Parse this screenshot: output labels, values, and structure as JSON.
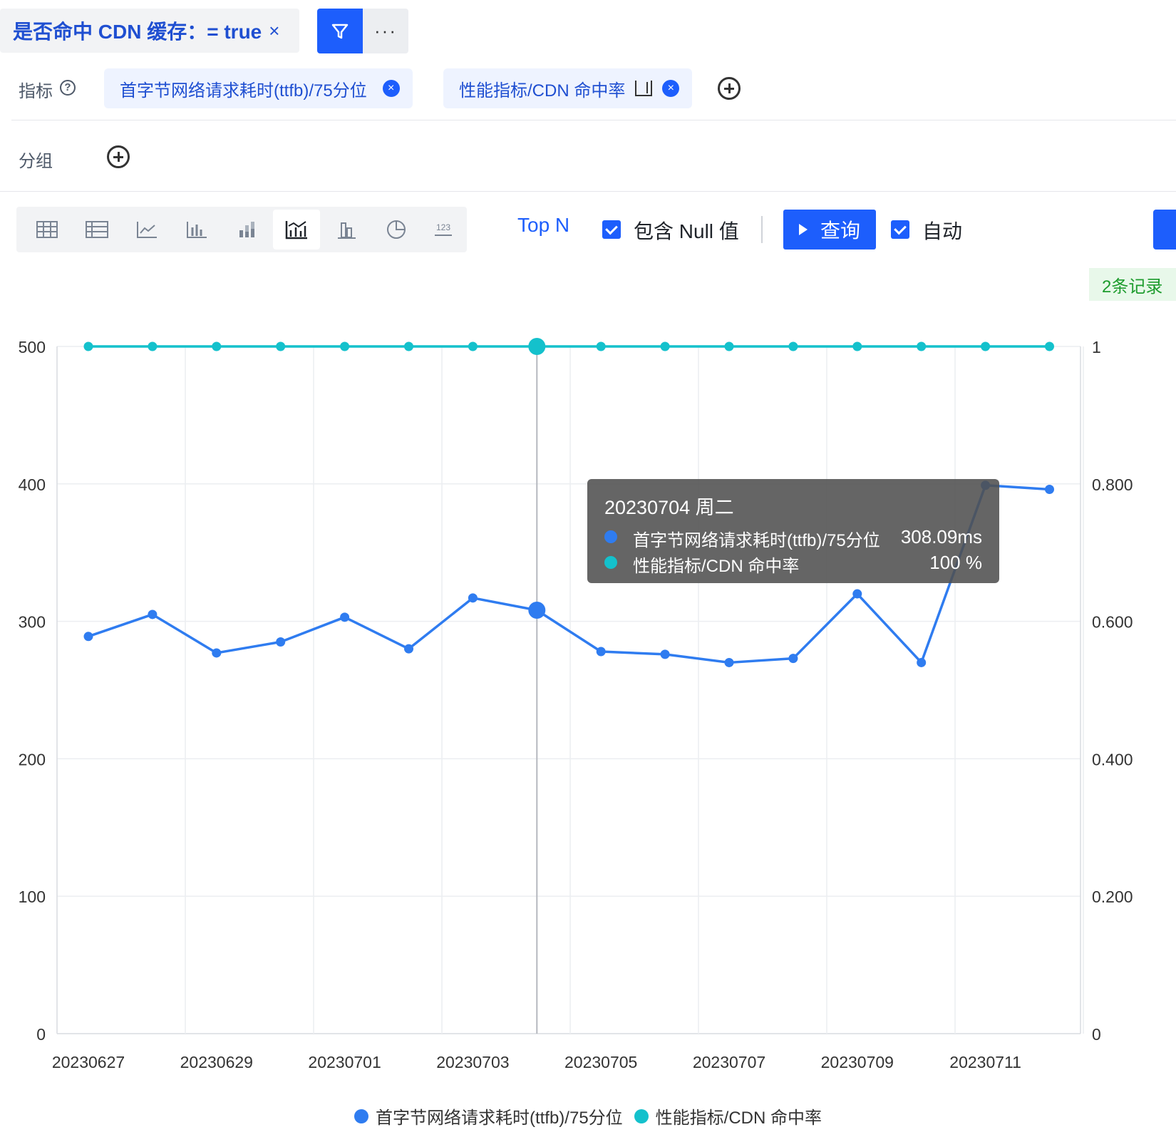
{
  "filter": {
    "label": "是否命中 CDN 缓存：= true",
    "close": "×"
  },
  "more_label": "···",
  "metrics_row": {
    "label": "指标",
    "help": "?",
    "chips": [
      {
        "label": "首字节网络请求耗时(ttfb)/75分位"
      },
      {
        "label": "性能指标/CDN 命中率"
      }
    ],
    "chip_close": "×"
  },
  "group_row": {
    "label": "分组"
  },
  "toolbar": {
    "chart_types": [
      "table-icon",
      "pivot-table-icon",
      "line-chart-icon",
      "bar-chart-icon",
      "stacked-bar-icon",
      "dual-axis-chart-icon",
      "column-chart-icon",
      "pie-chart-icon",
      "number-icon"
    ],
    "active_index": 5,
    "number_icon_text": "123",
    "top_n": "Top N",
    "include_null": "包含 Null 值",
    "query": "查询",
    "auto": "自动"
  },
  "records_badge": "2条记录",
  "colors": {
    "primary": "#1d5efc",
    "series1": "#2f7cf0",
    "series2": "#14c1cc"
  },
  "chart_data": {
    "type": "line",
    "x": [
      "20230627",
      "20230628",
      "20230629",
      "20230630",
      "20230701",
      "20230702",
      "20230703",
      "20230704",
      "20230705",
      "20230706",
      "20230707",
      "20230708",
      "20230709",
      "20230710",
      "20230711",
      "20230712"
    ],
    "x_tick_labels": [
      "20230627",
      "20230629",
      "20230701",
      "20230703",
      "20230705",
      "20230707",
      "20230709",
      "20230711"
    ],
    "series": [
      {
        "name": "首字节网络请求耗时(ttfb)/75分位",
        "axis": "left",
        "color": "#2f7cf0",
        "values": [
          289,
          305,
          277,
          285,
          303,
          280,
          317,
          308.09,
          278,
          276,
          270,
          273,
          320,
          270,
          399,
          396
        ]
      },
      {
        "name": "性能指标/CDN 命中率",
        "axis": "right",
        "color": "#14c1cc",
        "values": [
          1,
          1,
          1,
          1,
          1,
          1,
          1,
          1,
          1,
          1,
          1,
          1,
          1,
          1,
          1,
          1
        ]
      }
    ],
    "y_left": {
      "ticks": [
        "0",
        "100",
        "200",
        "300",
        "400",
        "500"
      ],
      "ylim": [
        0,
        500
      ]
    },
    "y_right": {
      "ticks": [
        "0",
        "0.200",
        "0.400",
        "0.600",
        "0.800",
        "1"
      ],
      "ylim": [
        0,
        1
      ]
    },
    "highlight_index": 7,
    "grid": true,
    "legend_position": "bottom-center",
    "tooltip": {
      "title": "20230704 周二",
      "rows": [
        {
          "name": "首字节网络请求耗时(ttfb)/75分位",
          "value": "308.09ms",
          "color": "#2f7cf0"
        },
        {
          "name": "性能指标/CDN 命中率",
          "value": "100 %",
          "color": "#14c1cc"
        }
      ]
    }
  }
}
